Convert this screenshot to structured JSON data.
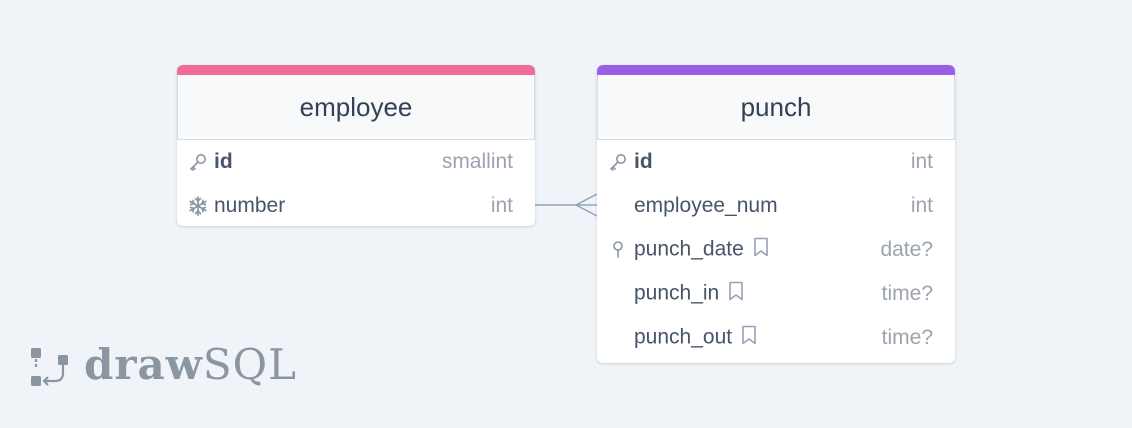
{
  "colors": {
    "employee_accent": "#f06c98",
    "punch_accent": "#9a5fe2",
    "background": "#f0f4f8",
    "connector": "#94a3b8"
  },
  "tables": {
    "employee": {
      "name": "employee",
      "columns": [
        {
          "name": "id",
          "type": "smallint",
          "icon": "key-icon",
          "primary": true
        },
        {
          "name": "number",
          "type": "int",
          "icon": "snowflake-icon",
          "primary": false
        }
      ]
    },
    "punch": {
      "name": "punch",
      "columns": [
        {
          "name": "id",
          "type": "int",
          "icon": "key-icon",
          "primary": true
        },
        {
          "name": "employee_num",
          "type": "int",
          "icon": "",
          "primary": false
        },
        {
          "name": "punch_date",
          "type": "date?",
          "icon": "index-pin-icon",
          "primary": false,
          "note": "bookmark-icon"
        },
        {
          "name": "punch_in",
          "type": "time?",
          "icon": "",
          "primary": false,
          "note": "bookmark-icon"
        },
        {
          "name": "punch_out",
          "type": "time?",
          "icon": "",
          "primary": false,
          "note": "bookmark-icon"
        }
      ]
    }
  },
  "relationship": {
    "from": "employee.number",
    "to": "punch.employee_num",
    "type": "one-to-many"
  },
  "logo": {
    "draw": "draw",
    "sql": "SQL"
  }
}
